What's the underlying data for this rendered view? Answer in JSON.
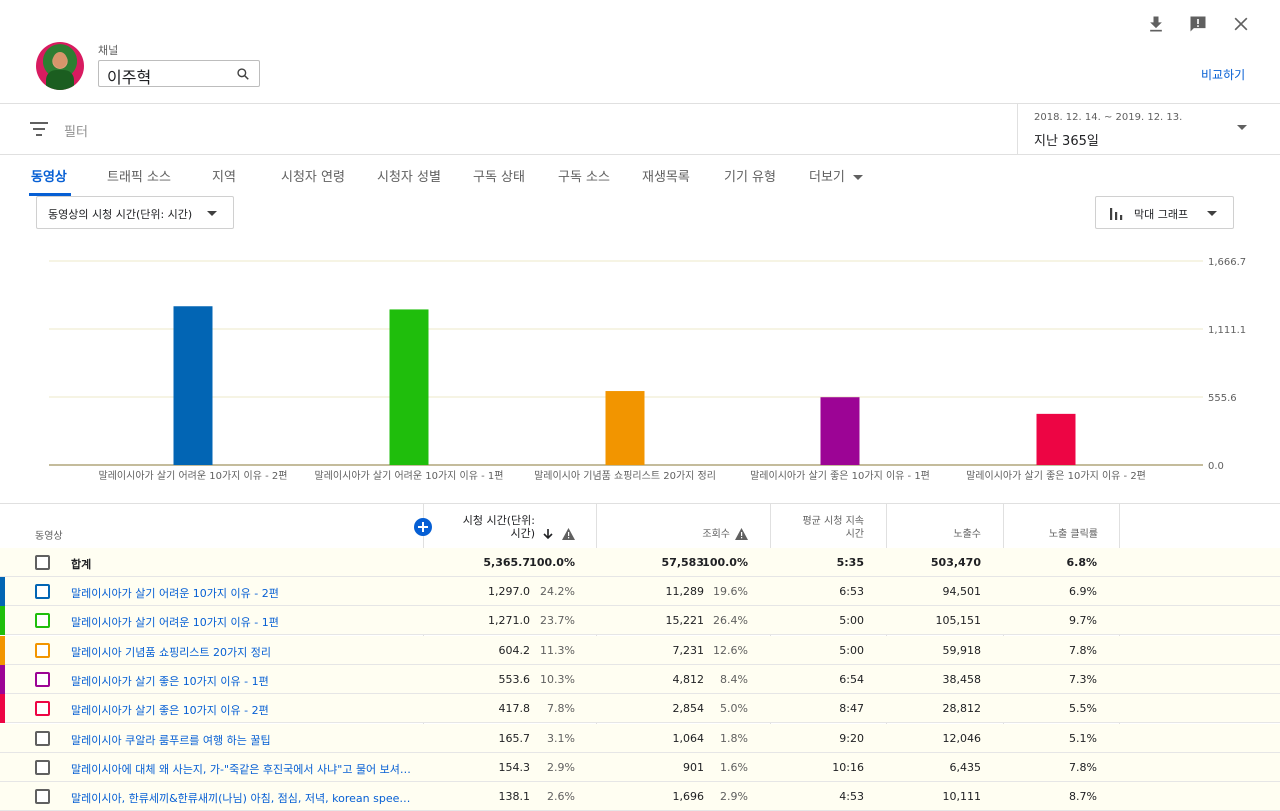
{
  "header": {
    "channel_label": "채널",
    "channel_name": "이주혁",
    "compare_label": "비교하기",
    "icons": [
      "download-icon",
      "feedback-icon",
      "close-icon"
    ]
  },
  "filter": {
    "placeholder": "필터",
    "date_range": "2018. 12. 14. ~ 2019. 12. 13.",
    "date_period": "지난 365일"
  },
  "tabs": [
    "동영상",
    "트래픽 소스",
    "지역",
    "시청자 연령",
    "시청자 성별",
    "구독 상태",
    "구독 소스",
    "재생목록",
    "기기 유형",
    "더보기"
  ],
  "active_tab": "동영상",
  "metric_select": "동영상의 시청 시간(단위: 시간)",
  "chart_type_select": "막대 그래프",
  "colors": {
    "accent": "#065fd4",
    "series": [
      "#0265b4",
      "#1fbe0c",
      "#f29500",
      "#9c0495",
      "#ed0544"
    ]
  },
  "chart_data": {
    "type": "bar",
    "categories": [
      "말레이시아가 살기 어려운 10가지 이유 - 2편",
      "말레이시아가 살기 어려운 10가지 이유 - 1편",
      "말레이시아 기념품 쇼핑리스트 20가지 정리",
      "말레이시아가 살기 좋은 10가지 이유 - 1편",
      "말레이시아가 살기 좋은 10가지 이유 - 2편"
    ],
    "values": [
      1297.0,
      1271.0,
      604.2,
      553.6,
      417.8
    ],
    "yticks": [
      "0.0",
      "555.6",
      "1,111.1",
      "1,666.7"
    ],
    "ylim": [
      0,
      1666.7
    ],
    "grid": true
  },
  "table": {
    "headers": {
      "video": "동영상",
      "watch_time": [
        "시청 시간(단위:",
        "시간)"
      ],
      "views": "조회수",
      "avg_duration": [
        "평균 시청 지속",
        "시간"
      ],
      "impressions": "노출수",
      "ctr": "노출 클릭률"
    },
    "total": {
      "label": "합계",
      "watch_time": "5,365.7",
      "watch_pct": "100.0%",
      "views": "57,583",
      "views_pct": "100.0%",
      "avg": "5:35",
      "impressions": "503,470",
      "ctr": "6.8%"
    },
    "rows": [
      {
        "title": "말레이시아가 살기 어려운 10가지 이유 - 2편",
        "watch_time": "1,297.0",
        "watch_pct": "24.2%",
        "views": "11,289",
        "views_pct": "19.6%",
        "avg": "6:53",
        "impressions": "94,501",
        "ctr": "6.9%",
        "color": "#0265b4"
      },
      {
        "title": "말레이시아가 살기 어려운 10가지 이유 - 1편",
        "watch_time": "1,271.0",
        "watch_pct": "23.7%",
        "views": "15,221",
        "views_pct": "26.4%",
        "avg": "5:00",
        "impressions": "105,151",
        "ctr": "9.7%",
        "color": "#1fbe0c"
      },
      {
        "title": "말레이시아 기념품 쇼핑리스트 20가지 정리",
        "watch_time": "604.2",
        "watch_pct": "11.3%",
        "views": "7,231",
        "views_pct": "12.6%",
        "avg": "5:00",
        "impressions": "59,918",
        "ctr": "7.8%",
        "color": "#f29500"
      },
      {
        "title": "말레이시아가 살기 좋은 10가지 이유 - 1편",
        "watch_time": "553.6",
        "watch_pct": "10.3%",
        "views": "4,812",
        "views_pct": "8.4%",
        "avg": "6:54",
        "impressions": "38,458",
        "ctr": "7.3%",
        "color": "#9c0495"
      },
      {
        "title": "말레이시아가 살기 좋은 10가지 이유 - 2편",
        "watch_time": "417.8",
        "watch_pct": "7.8%",
        "views": "2,854",
        "views_pct": "5.0%",
        "avg": "8:47",
        "impressions": "28,812",
        "ctr": "5.5%",
        "color": "#ed0544"
      },
      {
        "title": "말레이시아 쿠알라 룸푸르를 여행 하는 꿀팁",
        "watch_time": "165.7",
        "watch_pct": "3.1%",
        "views": "1,064",
        "views_pct": "1.8%",
        "avg": "9:20",
        "impressions": "12,046",
        "ctr": "5.1%",
        "color": ""
      },
      {
        "title": "말레이시아에 대체 왜 사는지, 가-\"죽같은 후진국에서 사냐\"고 물어 보셔서 ...",
        "watch_time": "154.3",
        "watch_pct": "2.9%",
        "views": "901",
        "views_pct": "1.6%",
        "avg": "10:16",
        "impressions": "6,435",
        "ctr": "7.8%",
        "color": ""
      },
      {
        "title": "말레이시아, 한류세끼&한류새끼(나님) 아침, 점심, 저녁, korean speech c...",
        "watch_time": "138.1",
        "watch_pct": "2.6%",
        "views": "1,696",
        "views_pct": "2.9%",
        "avg": "4:53",
        "impressions": "10,111",
        "ctr": "8.7%",
        "color": ""
      }
    ]
  }
}
